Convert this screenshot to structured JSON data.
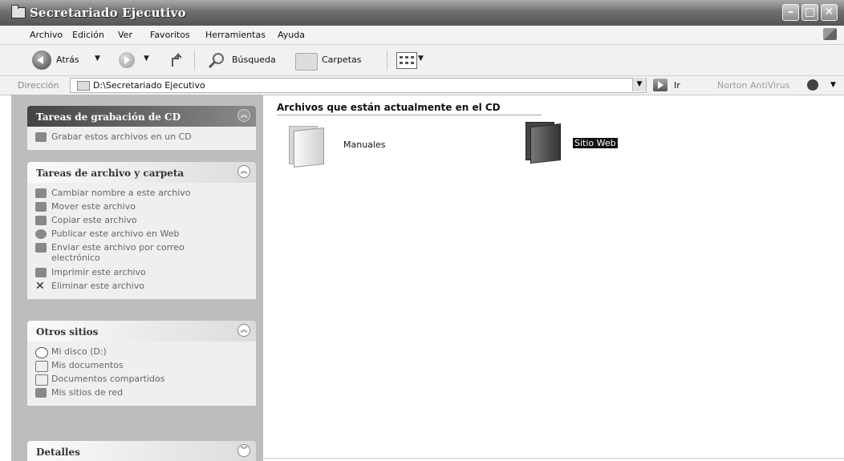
{
  "window": {
    "title": "Secretariado Ejecutivo"
  },
  "menu": [
    "Archivo",
    "Edición",
    "Ver",
    "Favoritos",
    "Herramientas",
    "Ayuda"
  ],
  "toolbar": {
    "back_label": "Atrás",
    "search_label": "Búsqueda",
    "folders_label": "Carpetas"
  },
  "address": {
    "label": "Dirección",
    "value": "D:\\Secretariado Ejecutivo",
    "go_label": "Ir",
    "antivirus_label": "Norton AntiVirus"
  },
  "panels": {
    "cd_tasks": {
      "title": "Tareas de grabación de CD",
      "items": [
        "Grabar estos archivos en un CD"
      ]
    },
    "file_tasks": {
      "title": "Tareas de archivo y carpeta",
      "items": [
        "Cambiar nombre a este archivo",
        "Mover este archivo",
        "Copiar este archivo",
        "Publicar este archivo en Web",
        "Enviar este archivo por correo electrónico",
        "Imprimir este archivo",
        "Eliminar este archivo"
      ]
    },
    "other_places": {
      "title": "Otros sitios",
      "items": [
        "Mi disco (D:)",
        "Mis documentos",
        "Documentos compartidos",
        "Mis sitios de red"
      ]
    },
    "details": {
      "title": "Detalles"
    }
  },
  "content": {
    "heading": "Archivos que están actualmente en el CD",
    "items": [
      {
        "name": "Manuales",
        "icon": "folder-icon",
        "selected": false
      },
      {
        "name": "Sitio Web",
        "icon": "folder-icon",
        "selected": true
      }
    ]
  }
}
